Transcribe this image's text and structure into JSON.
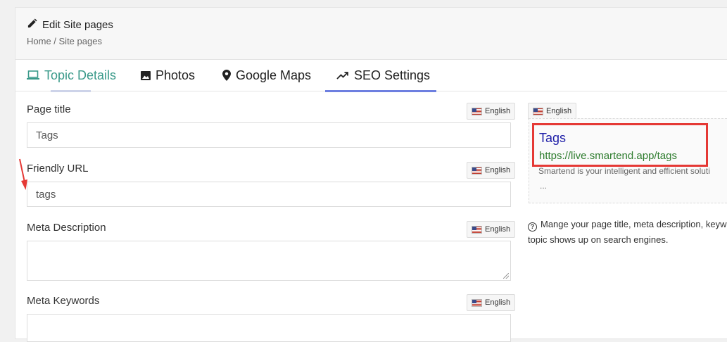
{
  "header": {
    "title": "Edit Site pages",
    "breadcrumb": "Home / Site pages"
  },
  "tabs": [
    {
      "label": "Topic Details",
      "icon": "laptop-icon",
      "state": "visited"
    },
    {
      "label": "Photos",
      "icon": "image-icon",
      "state": "normal"
    },
    {
      "label": "Google Maps",
      "icon": "map-pin-icon",
      "state": "normal"
    },
    {
      "label": "SEO Settings",
      "icon": "trend-up-icon",
      "state": "active"
    }
  ],
  "form": {
    "page_title": {
      "label": "Page title",
      "lang": "English",
      "value": "Tags"
    },
    "friendly_url": {
      "label": "Friendly URL",
      "lang": "English",
      "value": "tags"
    },
    "meta_description": {
      "label": "Meta Description",
      "lang": "English",
      "value": ""
    },
    "meta_keywords": {
      "label": "Meta Keywords",
      "lang": "English",
      "value": ""
    }
  },
  "preview": {
    "lang": "English",
    "title": "Tags",
    "url": "https://live.smartend.app/tags",
    "description": "Smartend is your intelligent and efficient soluti",
    "ellipsis": "..."
  },
  "help": {
    "line1": "Mange your page title, meta description, keyw",
    "line2": "topic shows up on search engines."
  },
  "colors": {
    "active_tab_underline": "#6d7fe0",
    "visited_tab_text": "#3a9a8a",
    "preview_title": "#1f1fa8",
    "preview_url": "#2f7d2f",
    "highlight": "#e53935"
  }
}
